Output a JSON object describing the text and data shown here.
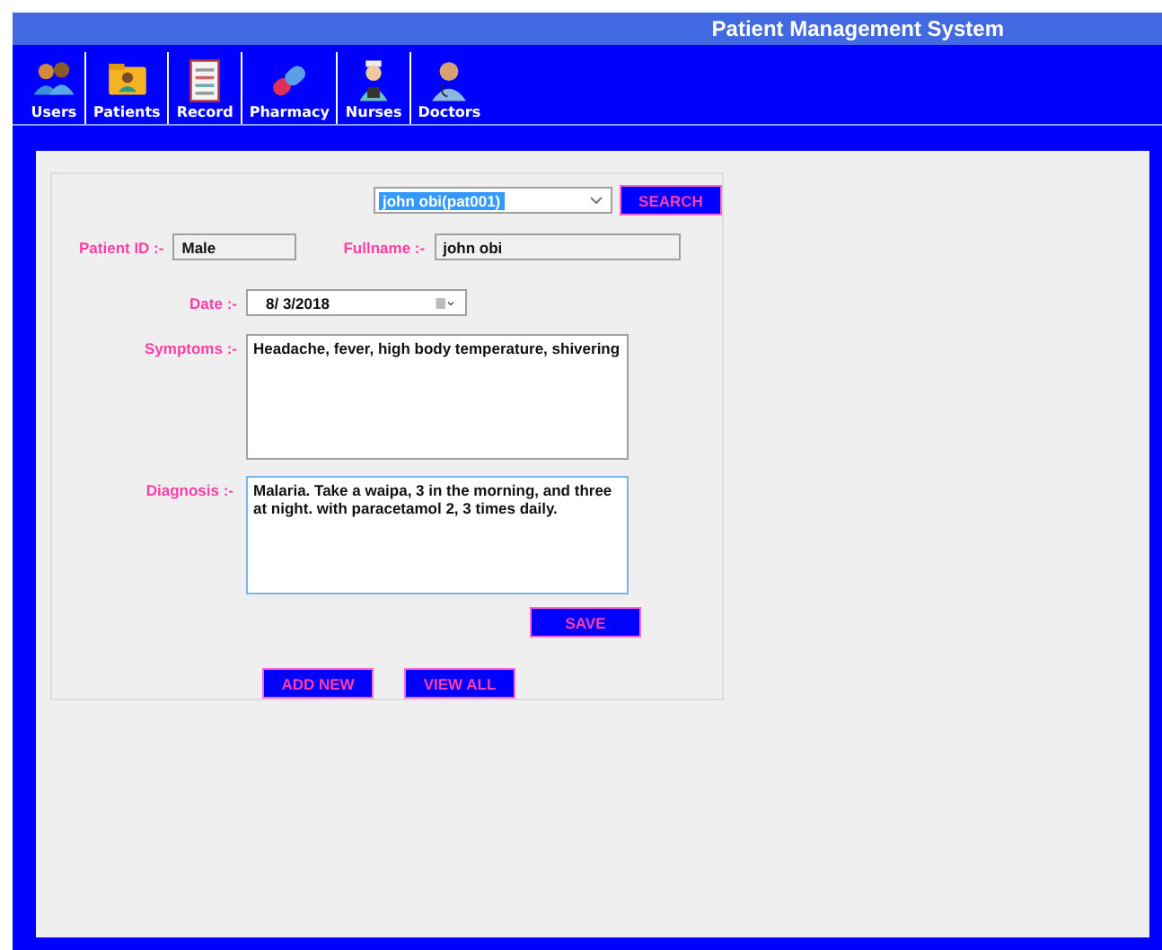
{
  "window": {
    "title": "Patient Management System"
  },
  "toolbar": [
    {
      "label": "Users",
      "kind": "users"
    },
    {
      "label": "Patients",
      "kind": "folder"
    },
    {
      "label": "Record",
      "kind": "record"
    },
    {
      "label": "Pharmacy",
      "kind": "pill"
    },
    {
      "label": "Nurses",
      "kind": "nurse"
    },
    {
      "label": "Doctors",
      "kind": "doctor"
    }
  ],
  "patient_select": {
    "value": "john obi(pat001)"
  },
  "search_button": "SEARCH",
  "patient_id": {
    "label": "Patient ID :-",
    "value": "Male"
  },
  "fullname": {
    "label": "Fullname :-",
    "value": "john obi"
  },
  "date": {
    "label": "Date :-",
    "value": "8/  3/2018"
  },
  "symptoms": {
    "label": "Symptoms :-",
    "value": "Headache, fever, high body temperature, shivering"
  },
  "diagnosis": {
    "label": "Diagnosis :-",
    "value": "Malaria. Take a waipa, 3 in the morning, and three at night. with paracetamol 2, 3 times daily."
  },
  "save_button": "SAVE",
  "bottom_buttons": [
    "ADD NEW",
    "VIEW ALL"
  ]
}
